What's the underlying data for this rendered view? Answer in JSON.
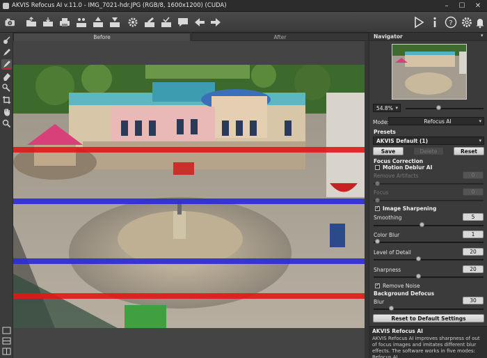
{
  "window": {
    "title": "AKVIS Refocus AI v.11.0 - IMG_7021-hdr.JPG (RGB/8, 1600x1200) (CUDA)",
    "minimize": "–",
    "maximize": "☐",
    "close": "✕"
  },
  "tabs": {
    "before": "Before",
    "after": "After"
  },
  "navigator": {
    "title": "Navigator",
    "zoom": "54.8%"
  },
  "settings": {
    "mode_label": "Mode:",
    "mode_value": "Refocus AI",
    "presets_label": "Presets",
    "preset_value": "AKVIS Default (1)",
    "save": "Save",
    "delete": "Delete",
    "reset": "Reset",
    "focus_correction": "Focus Correction",
    "motion_deblur": "Motion Deblur AI",
    "remove_artifacts": "Remove Artifacts",
    "remove_artifacts_value": "0",
    "focus": "Focus",
    "focus_value": "0",
    "image_sharpening": "Image Sharpening",
    "smoothing": "Smoothing",
    "smoothing_value": "5",
    "color_blur": "Color Blur",
    "color_blur_value": "1",
    "level_of_detail": "Level of Detail",
    "level_of_detail_value": "20",
    "sharpness": "Sharpness",
    "sharpness_value": "20",
    "remove_noise": "Remove Noise",
    "background_defocus": "Background Defocus",
    "blur": "Blur",
    "blur_value": "30",
    "reset_default": "Reset to Default Settings"
  },
  "info": {
    "title": "AKVIS Refocus AI",
    "text": "AKVIS Refocus AI improves sharpness of out of focus images and imitates different blur effects. The software works in five modes: Refocus AI,"
  },
  "colors": {
    "red_line": "#e01818",
    "blue_line": "#2a2ad8"
  }
}
